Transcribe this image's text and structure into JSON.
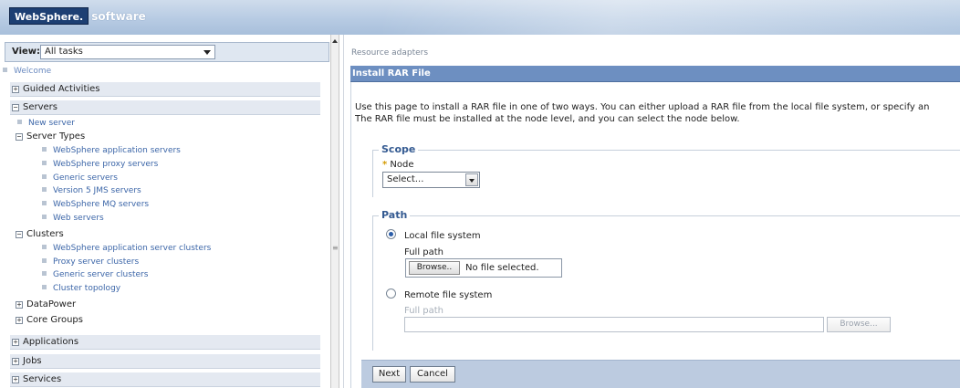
{
  "banner": {
    "logo_main": "WebSphere.",
    "logo_sub": "software"
  },
  "nav": {
    "view_label": "View:",
    "view_value": "All tasks",
    "welcome": "Welcome",
    "guided_activities": "Guided Activities",
    "servers": "Servers",
    "new_server": "New server",
    "server_types": "Server Types",
    "server_type_items": [
      "WebSphere application servers",
      "WebSphere proxy servers",
      "Generic servers",
      "Version 5 JMS servers",
      "WebSphere MQ servers",
      "Web servers"
    ],
    "clusters": "Clusters",
    "cluster_items": [
      "WebSphere application server clusters",
      "Proxy server clusters",
      "Generic server clusters",
      "Cluster topology"
    ],
    "datapower": "DataPower",
    "core_groups": "Core Groups",
    "applications": "Applications",
    "jobs": "Jobs",
    "services": "Services"
  },
  "content": {
    "breadcrumb": "Resource adapters",
    "title": "Install RAR File",
    "intro_line1": "Use this page to install a RAR file in one of two ways. You can either upload a RAR file from the local file system, or specify an",
    "intro_line2": "The RAR file must be installed at the node level, and you can select the node below.",
    "scope_title": "Scope",
    "node_star": "*",
    "node_label": "Node",
    "node_select": "Select...",
    "path_title": "Path",
    "local_label": "Local file system",
    "full_path_label": "Full path",
    "browse_label": "Browse..",
    "no_file": "No file selected.",
    "remote_label": "Remote file system",
    "remote_full_path_label": "Full path",
    "remote_browse": "Browse...",
    "next_button": "Next",
    "cancel_button": "Cancel"
  }
}
